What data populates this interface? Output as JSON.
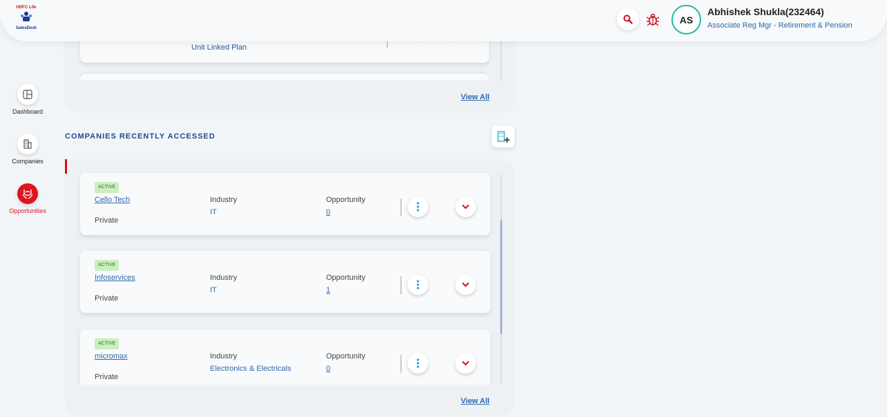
{
  "header": {
    "logo_top": "HDFC Life",
    "logo_bottom": "SalesDesk",
    "user_initials": "AS",
    "user_name": "Abhishek Shukla(232464)",
    "user_role": "Associate Reg Mgr - Retirement & Pension",
    "search_icon": "search-icon",
    "bug_icon": "bug-icon"
  },
  "sidebar": {
    "items": [
      {
        "label": "Dashboard",
        "icon": "dashboard-icon",
        "active": false
      },
      {
        "label": "Companies",
        "icon": "building-icon",
        "active": false
      },
      {
        "label": "Opportunities",
        "icon": "handshake-icon",
        "active": true
      }
    ]
  },
  "previous_panel": {
    "visible_plan_text": "Unit Linked Plan",
    "view_all": "View All"
  },
  "companies_section": {
    "title": "COMPANIES RECENTLY ACCESSED",
    "add_icon": "add-building-icon",
    "view_all": "View All",
    "industry_label": "Industry",
    "opportunity_label": "Opportunity",
    "companies": [
      {
        "status": "ACTIVE",
        "name": "Cello Tech",
        "type": "Private",
        "industry": "IT",
        "opportunities": "0"
      },
      {
        "status": "ACTIVE",
        "name": "Infoservices",
        "type": "Private",
        "industry": "IT",
        "opportunities": "1"
      },
      {
        "status": "ACTIVE",
        "name": "micromax",
        "type": "Private",
        "industry": "Electronics & Electricals",
        "opportunities": "0"
      }
    ]
  },
  "colors": {
    "brand_red": "#e0141e",
    "link_blue": "#2e67b1",
    "heading_blue": "#1d4a8f",
    "active_badge_bg": "#cdeec0",
    "avatar_ring": "#27b5a9"
  }
}
